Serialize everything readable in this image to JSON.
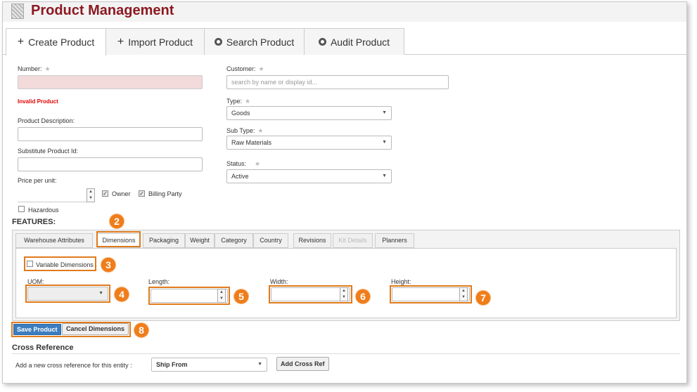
{
  "header": {
    "title": "Product Management"
  },
  "tabs": [
    {
      "label": "Create Product",
      "icon": "plus-icon",
      "active": true
    },
    {
      "label": "Import Product",
      "icon": "plus-icon",
      "active": false
    },
    {
      "label": "Search Product",
      "icon": "circle-icon",
      "active": false
    },
    {
      "label": "Audit Product",
      "icon": "circle-icon",
      "active": false
    }
  ],
  "form": {
    "number_label": "Number:",
    "number_value": "",
    "error_text": "Invalid Product",
    "description_label": "Product Description:",
    "substitute_label": "Substitute Product Id:",
    "price_label": "Price per unit:",
    "owner_label": "Owner",
    "billing_label": "Billing Party",
    "hazardous_label": "Hazardous",
    "customer_label": "Customer:",
    "customer_placeholder": "search by name or display id...",
    "type_label": "Type:",
    "type_value": "Goods",
    "subtype_label": "Sub Type:",
    "subtype_value": "Raw Materials",
    "status_label": "Status:",
    "status_value": "Active",
    "owner_checked": true,
    "billing_checked": true,
    "hazardous_checked": false
  },
  "features": {
    "title": "FEATURES:",
    "tabs": [
      "Warehouse Attributes",
      "Dimensions",
      "Packaging",
      "Weight",
      "Category",
      "Country",
      "Revisions",
      "Kit Details",
      "Planners"
    ],
    "active_tab": "Dimensions",
    "variable_dimensions_label": "Variable Dimensions",
    "uom_label": "UOM:",
    "length_label": "Length:",
    "width_label": "Width:",
    "height_label": "Height:"
  },
  "actions": {
    "save_label": "Save Product",
    "cancel_label": "Cancel Dimensions"
  },
  "cross_reference": {
    "title": "Cross Reference",
    "prompt": "Add a new cross reference for this entity :",
    "select_value": "Ship From",
    "add_label": "Add Cross Ref"
  },
  "callouts": [
    "2",
    "3",
    "4",
    "5",
    "6",
    "7",
    "8"
  ],
  "colors": {
    "title": "#8b1a22",
    "callout": "#ef7d1a",
    "error": "#e00000",
    "primary": "#3b7dbf"
  }
}
